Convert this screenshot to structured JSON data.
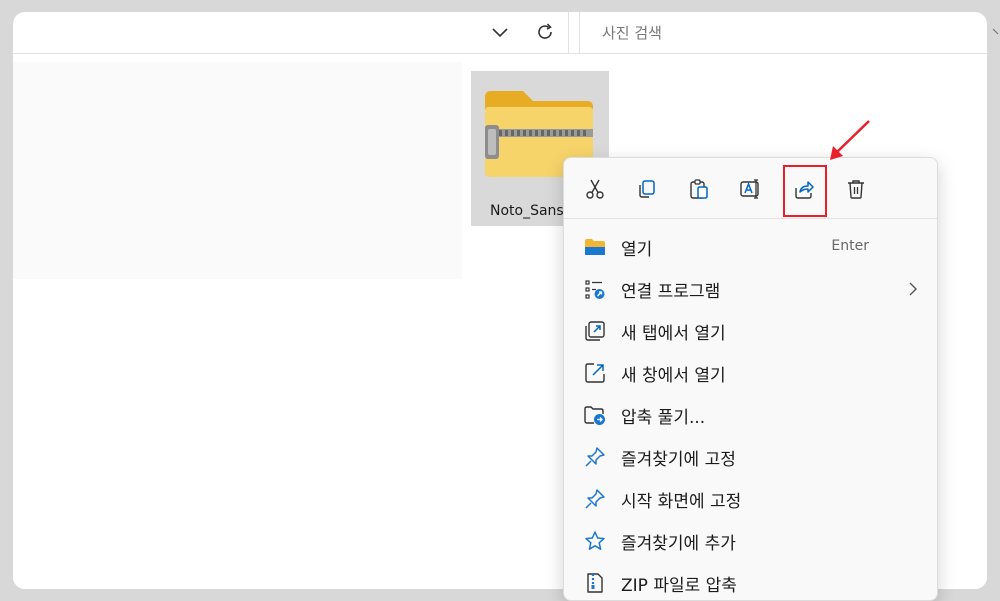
{
  "search": {
    "placeholder": "사진 검색"
  },
  "file": {
    "name": "Noto_Sans"
  },
  "actions": [
    {
      "name": "cut-icon"
    },
    {
      "name": "copy-icon"
    },
    {
      "name": "paste-icon"
    },
    {
      "name": "rename-icon"
    },
    {
      "name": "share-icon"
    },
    {
      "name": "delete-icon"
    }
  ],
  "menu": {
    "open": {
      "label": "열기",
      "shortcut": "Enter"
    },
    "open_with": {
      "label": "연결 프로그램"
    },
    "open_new_tab": {
      "label": "새 탭에서 열기"
    },
    "open_new_window": {
      "label": "새 창에서 열기"
    },
    "extract": {
      "label": "압축 풀기..."
    },
    "pin_quick_access": {
      "label": "즐겨찾기에 고정"
    },
    "pin_start": {
      "label": "시작 화면에 고정"
    },
    "add_favorites": {
      "label": "즐겨찾기에 추가"
    },
    "compress_zip": {
      "label": "ZIP 파일로 압축"
    }
  },
  "colors": {
    "accent": "#0067c0",
    "highlight": "#e8202a",
    "folder": "#f7c948"
  }
}
